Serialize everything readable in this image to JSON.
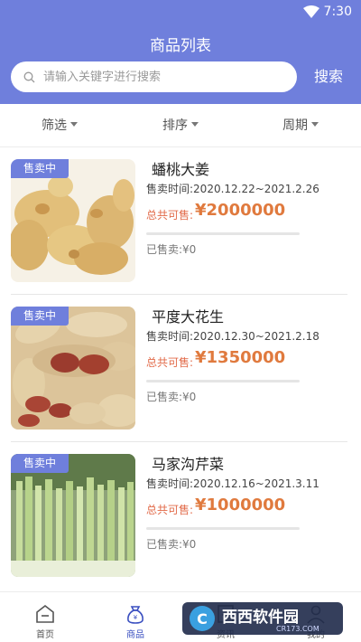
{
  "status_bar": {
    "time": "7:30",
    "wifi_icon": "wifi-icon"
  },
  "header": {
    "title": "商品列表"
  },
  "search": {
    "placeholder": "请输入关键字进行搜索",
    "value": "",
    "button_label": "搜索",
    "icon": "search-icon"
  },
  "filters": [
    {
      "label": "筛选",
      "icon": "caret-down-icon"
    },
    {
      "label": "排序",
      "icon": "caret-down-icon"
    },
    {
      "label": "周期",
      "icon": "caret-down-icon"
    }
  ],
  "products": [
    {
      "badge": "售卖中",
      "name": "蟠桃大姜",
      "time": "售卖时间:2020.12.22~2021.2.26",
      "total_label": "总共可售:",
      "total_value": "¥2000000",
      "sold": "已售卖:¥0",
      "sold_fraction": 0,
      "image": "ginger-photo"
    },
    {
      "badge": "售卖中",
      "name": "平度大花生",
      "time": "售卖时间:2020.12.30~2021.2.18",
      "total_label": "总共可售:",
      "total_value": "¥1350000",
      "sold": "已售卖:¥0",
      "sold_fraction": 0,
      "image": "peanut-photo"
    },
    {
      "badge": "售卖中",
      "name": "马家沟芹菜",
      "time": "售卖时间:2020.12.16~2021.3.11",
      "total_label": "总共可售:",
      "total_value": "¥1000000",
      "sold": "已售卖:¥0",
      "sold_fraction": 0,
      "image": "celery-photo"
    }
  ],
  "tabbar": [
    {
      "label": "首页",
      "icon": "home-icon",
      "active": false
    },
    {
      "label": "商品",
      "icon": "bag-icon",
      "active": true
    },
    {
      "label": "资讯",
      "icon": "news-icon",
      "active": false
    },
    {
      "label": "我的",
      "icon": "user-icon",
      "active": false
    }
  ],
  "watermark": {
    "text": "西西软件园",
    "sub": "CR173.COM"
  },
  "colors": {
    "header": "#6f7fdc",
    "accent": "#e07a3e",
    "active_tab": "#3a4fc0"
  }
}
